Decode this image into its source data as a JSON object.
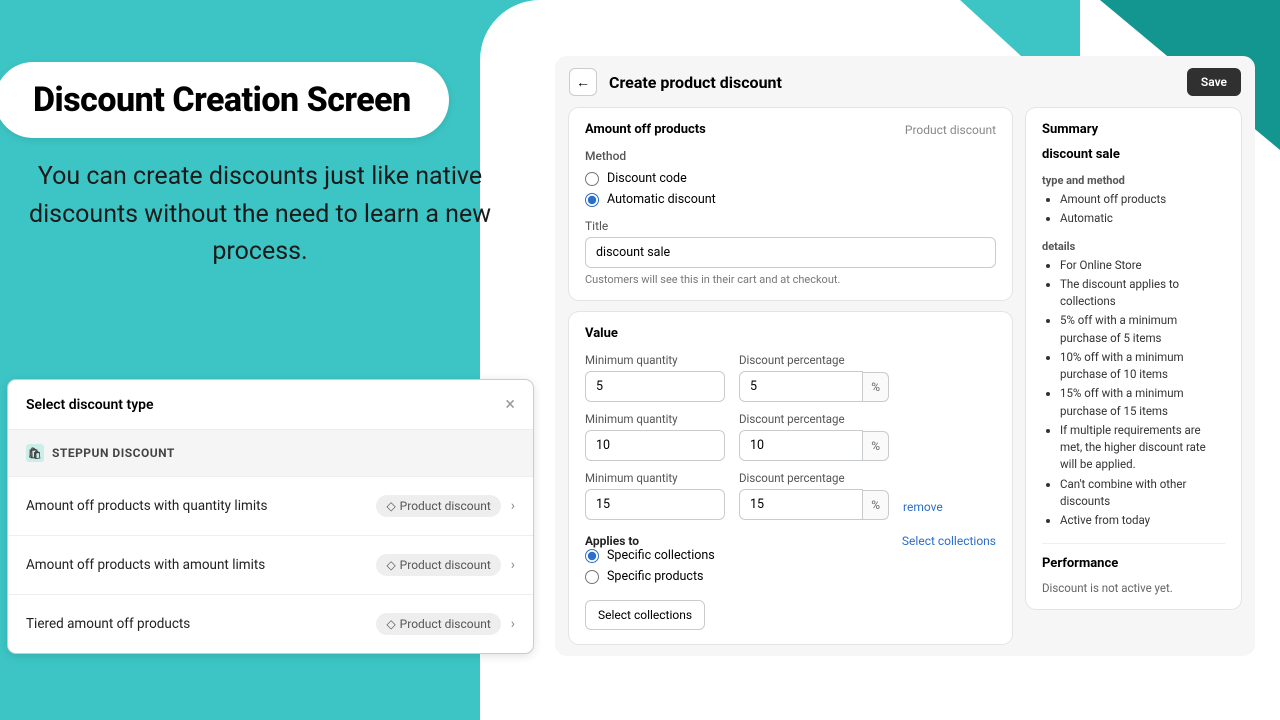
{
  "marketing": {
    "title": "Discount Creation Screen",
    "subtitle": "You can create discounts just like native discounts without the need to learn a new process."
  },
  "dialog": {
    "title": "Select discount type",
    "app_name": "STEPPUN DISCOUNT",
    "badge": "Product discount",
    "types": [
      {
        "label": "Amount off products with quantity limits"
      },
      {
        "label": "Amount off products with amount limits"
      },
      {
        "label": "Tiered amount off products"
      }
    ]
  },
  "admin": {
    "page_title": "Create product discount",
    "save": "Save",
    "card": {
      "title": "Amount off products",
      "type_badge": "Product discount",
      "method_label": "Method",
      "method_code": "Discount code",
      "method_auto": "Automatic discount",
      "title_label": "Title",
      "title_value": "discount sale",
      "title_help": "Customers will see this in their cart and at checkout."
    },
    "value": {
      "title": "Value",
      "min_label": "Minimum quantity",
      "pct_label": "Discount percentage",
      "remove": "remove",
      "tiers": [
        {
          "qty": "5",
          "pct": "5"
        },
        {
          "qty": "10",
          "pct": "10"
        },
        {
          "qty": "15",
          "pct": "15"
        }
      ]
    },
    "applies": {
      "label": "Applies to",
      "link": "Select collections",
      "opt1": "Specific collections",
      "opt2": "Specific products",
      "btn": "Select collections"
    },
    "summary": {
      "title": "Summary",
      "name": "discount sale",
      "type_heading": "type and method",
      "type_items": [
        "Amount off products",
        "Automatic"
      ],
      "details_heading": "details",
      "details_items": [
        "For Online Store",
        "The discount applies to collections",
        "5% off with a minimum purchase of 5 items",
        "10% off with a minimum purchase of 10 items",
        "15% off with a minimum purchase of 15 items",
        "If multiple requirements are met, the higher discount rate will be applied.",
        "Can't combine with other discounts",
        "Active from today"
      ],
      "perf_title": "Performance",
      "perf_text": "Discount is not active yet."
    }
  }
}
